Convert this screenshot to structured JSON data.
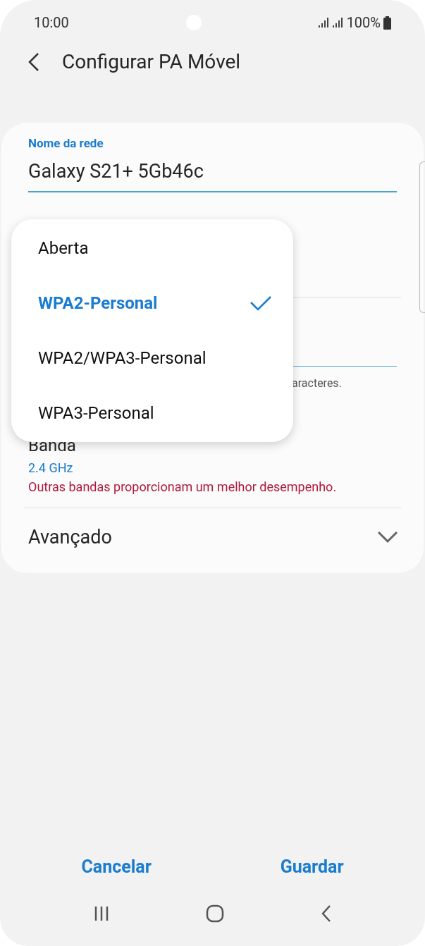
{
  "status_bar": {
    "time": "10:00",
    "battery": "100%"
  },
  "header": {
    "title": "Configurar PA Móvel"
  },
  "network_name": {
    "label": "Nome da rede",
    "value": "Galaxy S21+ 5Gb46c"
  },
  "password_hint": "aracteres.",
  "band": {
    "label": "Banda",
    "value": "2.4 GHz",
    "warning": "Outras bandas proporcionam um melhor desempenho."
  },
  "advanced": {
    "label": "Avançado",
    "expanded": false
  },
  "security_menu": [
    {
      "label": "Aberta",
      "selected": false
    },
    {
      "label": "WPA2-Personal",
      "selected": true
    },
    {
      "label": "WPA2/WPA3-Personal",
      "selected": false
    },
    {
      "label": "WPA3-Personal",
      "selected": false
    }
  ],
  "buttons": [
    "Cancelar",
    "Guardar"
  ]
}
